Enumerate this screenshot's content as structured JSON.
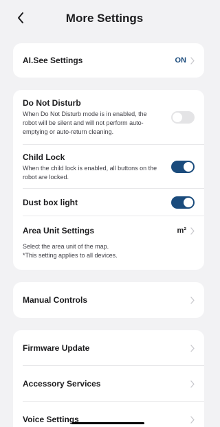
{
  "header": {
    "title": "More Settings"
  },
  "ai_see": {
    "label": "AI.See Settings",
    "value": "ON"
  },
  "dnd": {
    "label": "Do Not Disturb",
    "description": "When Do Not Disturb mode is in enabled, the robot will be silent and will not perform auto-emptying or auto-return cleaning.",
    "enabled": false
  },
  "child_lock": {
    "label": "Child Lock",
    "description": "When the child lock is enabled, all buttons on the robot are locked.",
    "enabled": true
  },
  "dust_box_light": {
    "label": "Dust box light",
    "enabled": true
  },
  "area_unit": {
    "label": "Area Unit Settings",
    "value": "m²",
    "description": "Select the area unit of the map.",
    "note": "*This setting applies to all devices."
  },
  "manual_controls": {
    "label": "Manual Controls"
  },
  "firmware_update": {
    "label": "Firmware Update"
  },
  "accessory_services": {
    "label": "Accessory Services"
  },
  "voice_settings": {
    "label": "Voice Settings"
  },
  "colors": {
    "accent": "#1a4b7c",
    "toggle_off": "#e4e4e6",
    "background": "#f2f2f4"
  },
  "icons": {
    "back": "chevron-left-icon",
    "row_arrow": "chevron-right-icon"
  }
}
